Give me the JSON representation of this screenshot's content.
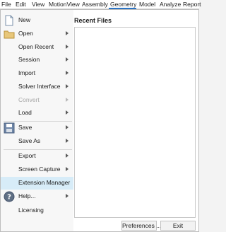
{
  "menubar": {
    "items": [
      "File",
      "Edit",
      "View",
      "MotionView",
      "Assembly",
      "Geometry",
      "Model",
      "Analyze",
      "Report"
    ],
    "active": "Geometry"
  },
  "file_menu": {
    "new": "New",
    "open": "Open",
    "open_recent": "Open Recent",
    "session": "Session",
    "import": "Import",
    "solver_interface": "Solver Interface",
    "convert": "Convert",
    "load": "Load",
    "save": "Save",
    "save_as": "Save As",
    "export": "Export",
    "screen_capture": "Screen Capture",
    "extension_manager": "Extension Manager",
    "help": "Help...",
    "licensing": "Licensing"
  },
  "recent": {
    "title": "Recent Files"
  },
  "buttons": {
    "preferences": "Preferences ...",
    "exit": "Exit"
  },
  "colors": {
    "highlight": "#d7ecf8",
    "active_tab_underline": "#2a73c4"
  }
}
